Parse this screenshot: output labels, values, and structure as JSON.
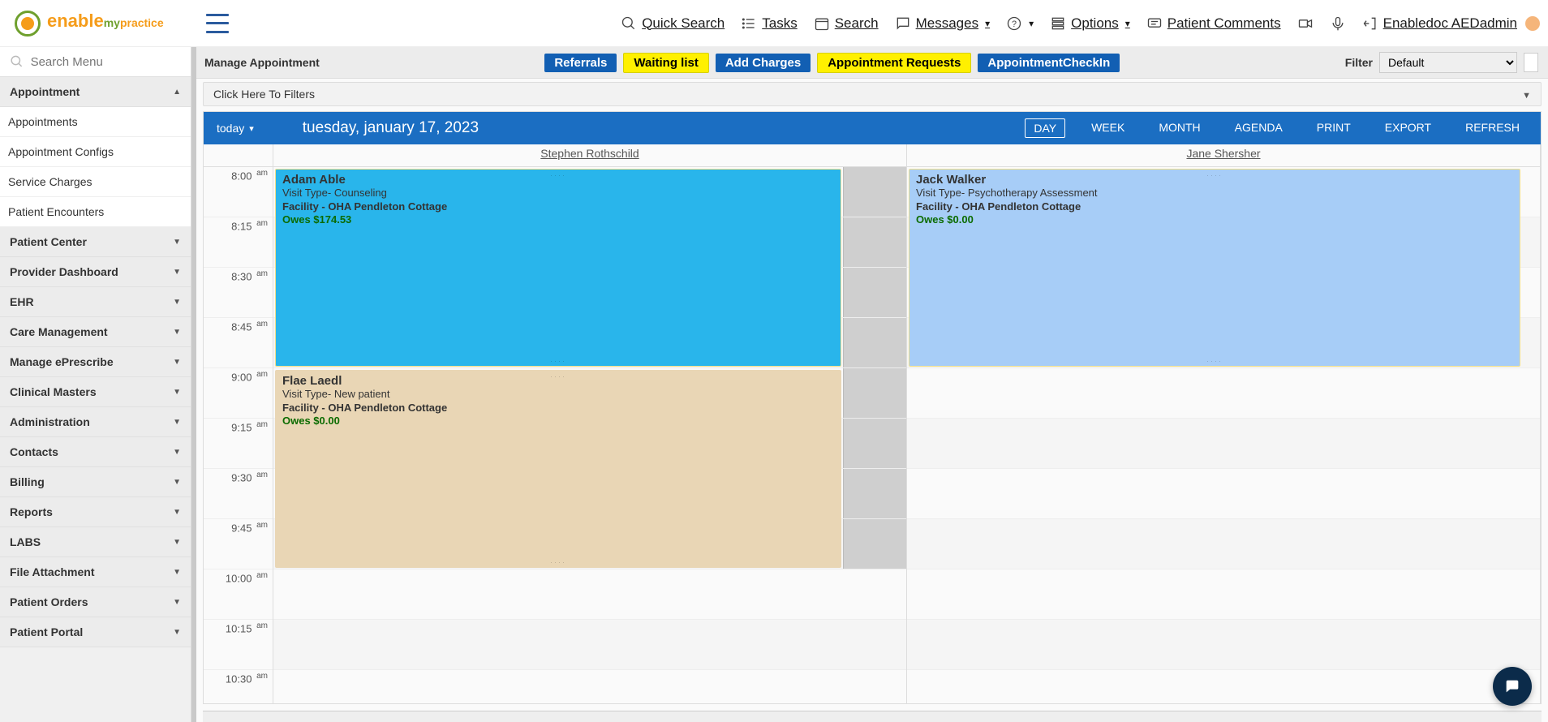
{
  "logo": {
    "word1": "enable",
    "word2": "my",
    "word3": "practice"
  },
  "topnav": {
    "quick_search": "Quick Search",
    "tasks": "Tasks",
    "search": "Search",
    "messages": "Messages",
    "options": "Options",
    "patient_comments": "Patient Comments",
    "user": "Enabledoc AEDadmin"
  },
  "sidebar": {
    "search_placeholder": "Search Menu",
    "groups": [
      {
        "label": "Appointment",
        "expanded": true,
        "items": [
          "Appointments",
          "Appointment Configs",
          "Service Charges",
          "Patient Encounters"
        ]
      },
      {
        "label": "Patient Center"
      },
      {
        "label": "Provider Dashboard"
      },
      {
        "label": "EHR"
      },
      {
        "label": "Care Management"
      },
      {
        "label": "Manage ePrescribe"
      },
      {
        "label": "Clinical Masters"
      },
      {
        "label": "Administration"
      },
      {
        "label": "Contacts"
      },
      {
        "label": "Billing"
      },
      {
        "label": "Reports"
      },
      {
        "label": "LABS"
      },
      {
        "label": "File Attachment"
      },
      {
        "label": "Patient Orders"
      },
      {
        "label": "Patient Portal"
      }
    ]
  },
  "page": {
    "title": "Manage Appointment",
    "pills": {
      "referrals": "Referrals",
      "waiting": "Waiting list",
      "add_charges": "Add Charges",
      "appt_requests": "Appointment Requests",
      "checkin": "AppointmentCheckIn"
    },
    "filter_label": "Filter",
    "filter_value": "Default",
    "filters_toggle": "Click Here To Filters"
  },
  "calendar": {
    "today": "today",
    "date": "tuesday, january 17, 2023",
    "views": {
      "day": "DAY",
      "week": "WEEK",
      "month": "MONTH",
      "agenda": "AGENDA",
      "print": "PRINT",
      "export": "EXPORT",
      "refresh": "REFRESH"
    },
    "resources": [
      "Stephen Rothschild",
      "Jane Shersher"
    ],
    "timeslots": [
      "8:00",
      "8:15",
      "8:30",
      "8:45",
      "9:00",
      "9:15",
      "9:30",
      "9:45",
      "10:00",
      "10:15",
      "10:30"
    ],
    "am": "am"
  },
  "appointments": {
    "a1": {
      "name": "Adam Able",
      "vt": "Visit Type- Counseling",
      "fac": "Facility - OHA Pendleton Cottage",
      "owes": "Owes $174.53"
    },
    "a2": {
      "name": "Flae Laedl",
      "vt": "Visit Type- New patient",
      "fac": "Facility - OHA Pendleton Cottage",
      "owes": "Owes $0.00"
    },
    "a3": {
      "name": "Jack Walker",
      "vt": "Visit Type- Psychotherapy Assessment",
      "fac": "Facility - OHA Pendleton Cottage",
      "owes": "Owes $0.00"
    }
  }
}
